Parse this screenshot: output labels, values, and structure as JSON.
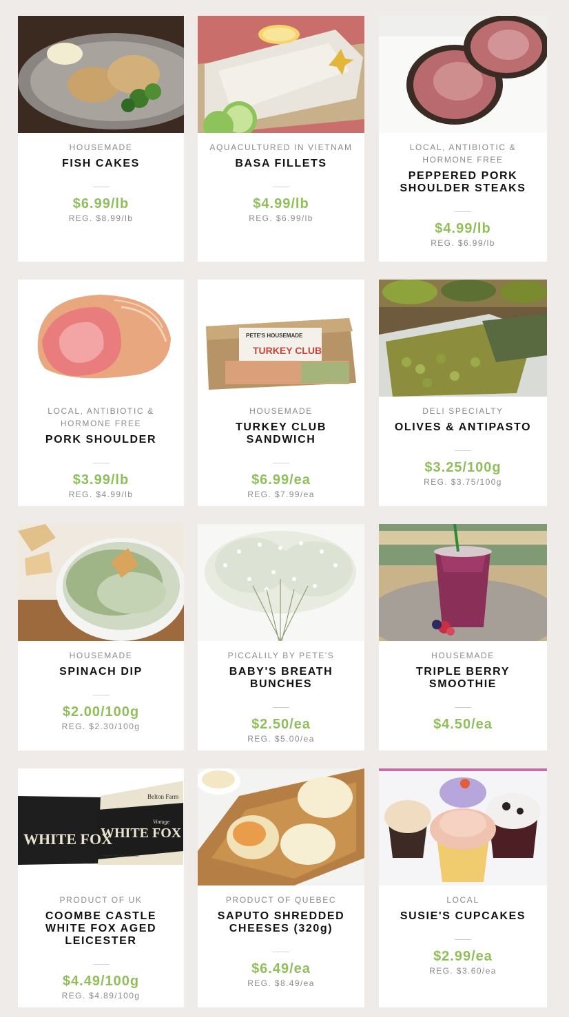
{
  "products": [
    {
      "origin": "HOUSEMADE",
      "name": "FISH CAKES",
      "price": "$6.99/lb",
      "reg": "REG. $8.99/lb"
    },
    {
      "origin": "AQUACULTURED IN VIETNAM",
      "name": "BASA FILLETS",
      "price": "$4.99/lb",
      "reg": "REG. $6.99/lb"
    },
    {
      "origin": "LOCAL, ANTIBIOTIC & HORMONE FREE",
      "name": "PEPPERED PORK SHOULDER STEAKS",
      "price": "$4.99/lb",
      "reg": "REG. $6.99/lb"
    },
    {
      "origin": "LOCAL, ANTIBIOTIC & HORMONE FREE",
      "name": "PORK SHOULDER",
      "price": "$3.99/lb",
      "reg": "REG. $4.99/lb"
    },
    {
      "origin": "HOUSEMADE",
      "name": "TURKEY CLUB SANDWICH",
      "price": "$6.99/ea",
      "reg": "REG. $7.99/ea"
    },
    {
      "origin": "DELI SPECIALTY",
      "name": "OLIVES & ANTIPASTO",
      "price": "$3.25/100g",
      "reg": "REG. $3.75/100g"
    },
    {
      "origin": "HOUSEMADE",
      "name": "SPINACH DIP",
      "price": "$2.00/100g",
      "reg": "REG. $2.30/100g"
    },
    {
      "origin": "PICCALILY BY PETE'S",
      "name": "BABY'S BREATH BUNCHES",
      "price": "$2.50/ea",
      "reg": "REG. $5.00/ea"
    },
    {
      "origin": "HOUSEMADE",
      "name": "TRIPLE BERRY SMOOTHIE",
      "price": "$4.50/ea",
      "reg": ""
    },
    {
      "origin": "PRODUCT OF UK",
      "name": "COOMBE CASTLE WHITE FOX AGED LEICESTER",
      "price": "$4.49/100g",
      "reg": "REG. $4.89/100g"
    },
    {
      "origin": "PRODUCT OF QUEBEC",
      "name": "SAPUTO SHREDDED CHEESES (320g)",
      "price": "$6.49/ea",
      "reg": "REG. $8.49/ea"
    },
    {
      "origin": "LOCAL",
      "name": "SUSIE'S CUPCAKES",
      "price": "$2.99/ea",
      "reg": "REG. $3.60/ea"
    }
  ],
  "packaging": {
    "turkey_brand": "PETE'S HOUSEMADE",
    "turkey_label": "TURKEY CLUB",
    "cheese_brand": "Belton Farm",
    "cheese_name": "WHITE FOX",
    "cheese_vintage": "Vintage",
    "cheese_sub": "Aged White Leicester"
  },
  "colors": {
    "page_bg": "#efebe8",
    "card_bg": "#ffffff",
    "price_green": "#8fbf5a",
    "muted_text": "#8a8a8a",
    "title_text": "#111111"
  }
}
